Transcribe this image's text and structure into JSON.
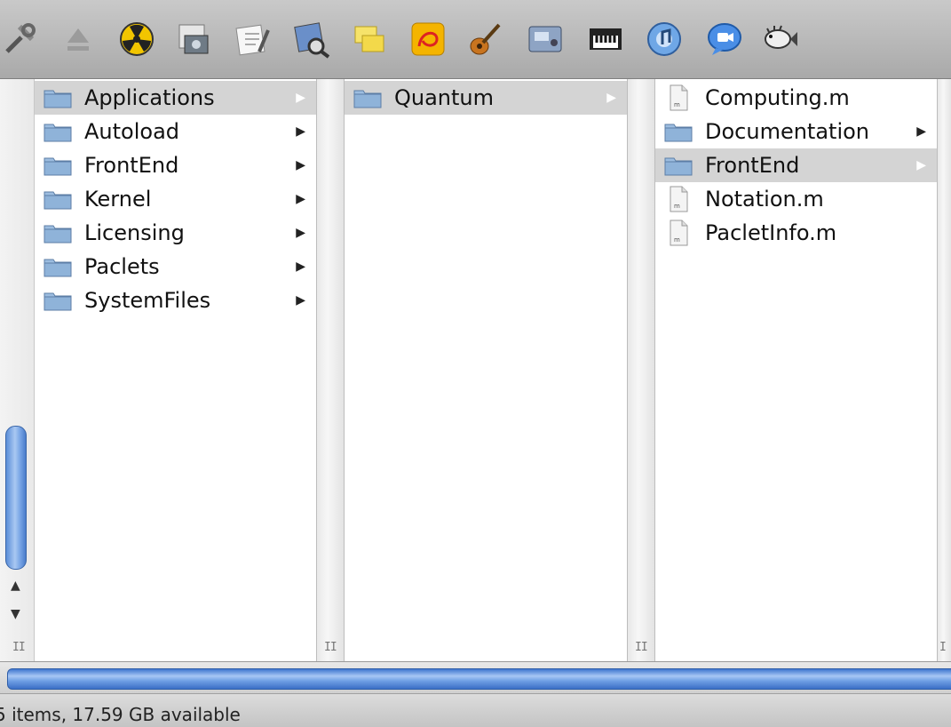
{
  "toolbar": {
    "icons": [
      "tools-icon",
      "eject-icon",
      "burn-icon",
      "photo-desktop-icon",
      "text-edit-icon",
      "preview-icon",
      "stickies-icon",
      "wolfram-icon",
      "garageband-icon",
      "audio-app-icon",
      "keyboard-icon",
      "itunes-icon",
      "ichat-icon",
      "blowfish-icon"
    ]
  },
  "columns": [
    {
      "items": [
        {
          "name": "Applications",
          "kind": "folder",
          "selected": true,
          "has_children": true
        },
        {
          "name": "Autoload",
          "kind": "folder",
          "selected": false,
          "has_children": true
        },
        {
          "name": "FrontEnd",
          "kind": "folder",
          "selected": false,
          "has_children": true
        },
        {
          "name": "Kernel",
          "kind": "folder",
          "selected": false,
          "has_children": true
        },
        {
          "name": "Licensing",
          "kind": "folder",
          "selected": false,
          "has_children": true
        },
        {
          "name": "Paclets",
          "kind": "folder",
          "selected": false,
          "has_children": true
        },
        {
          "name": "SystemFiles",
          "kind": "folder",
          "selected": false,
          "has_children": true
        }
      ]
    },
    {
      "items": [
        {
          "name": "Quantum",
          "kind": "folder",
          "selected": true,
          "has_children": true
        }
      ]
    },
    {
      "items": [
        {
          "name": "Computing.m",
          "kind": "file",
          "selected": false,
          "has_children": false
        },
        {
          "name": "Documentation",
          "kind": "folder",
          "selected": false,
          "has_children": true
        },
        {
          "name": "FrontEnd",
          "kind": "folder",
          "selected": true,
          "has_children": true
        },
        {
          "name": "Notation.m",
          "kind": "file",
          "selected": false,
          "has_children": false
        },
        {
          "name": "PacletInfo.m",
          "kind": "file",
          "selected": false,
          "has_children": false
        }
      ]
    }
  ],
  "status": {
    "text": "5 items, 17.59 GB available"
  },
  "colors": {
    "selection": "#d4d4d4",
    "folder_blue": "#8fb3d9",
    "scroll_blue": "#5b8ed8"
  }
}
